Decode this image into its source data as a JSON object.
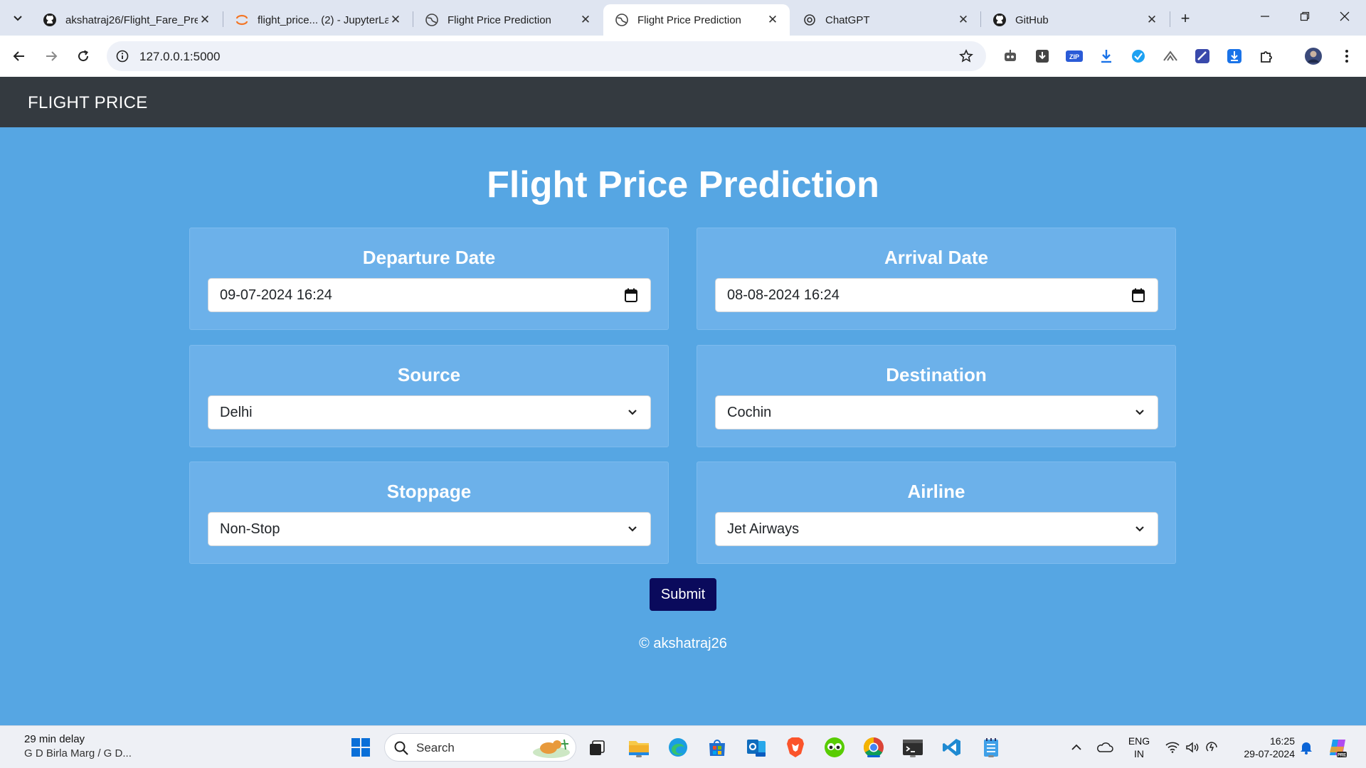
{
  "browser": {
    "tabs": [
      {
        "title": "akshatraj26/Flight_Fare_Pre",
        "icon": "github-icon",
        "active": false
      },
      {
        "title": "flight_price... (2) - JupyterLa",
        "icon": "jupyter-icon",
        "active": false
      },
      {
        "title": "Flight Price Prediction",
        "icon": "globe-icon",
        "active": false
      },
      {
        "title": "Flight Price Prediction",
        "icon": "globe-icon",
        "active": true
      },
      {
        "title": "ChatGPT",
        "icon": "chatgpt-icon",
        "active": false
      },
      {
        "title": "GitHub",
        "icon": "github-icon",
        "active": false
      }
    ],
    "url": "127.0.0.1:5000"
  },
  "page": {
    "brand": "FLIGHT PRICE",
    "heading": "Flight Price Prediction",
    "fields": {
      "departure": {
        "label": "Departure Date",
        "value": "09-07-2024  16:24"
      },
      "arrival": {
        "label": "Arrival Date",
        "value": "08-08-2024  16:24"
      },
      "source": {
        "label": "Source",
        "value": "Delhi"
      },
      "destination": {
        "label": "Destination",
        "value": "Cochin"
      },
      "stoppage": {
        "label": "Stoppage",
        "value": "Non-Stop"
      },
      "airline": {
        "label": "Airline",
        "value": "Jet Airways"
      }
    },
    "submit_label": "Submit",
    "footer": "© akshatraj26"
  },
  "taskbar": {
    "weather_line1": "29 min delay",
    "weather_line2": "G D Birla Marg / G D...",
    "search_label": "Search",
    "lang_line1": "ENG",
    "lang_line2": "IN",
    "time": "16:25",
    "date": "29-07-2024"
  },
  "colors": {
    "page_bg": "#56a6e3",
    "navbar_bg": "#343a40",
    "card_bg": "#6cb1ea",
    "submit_bg": "#0a0a5c"
  }
}
